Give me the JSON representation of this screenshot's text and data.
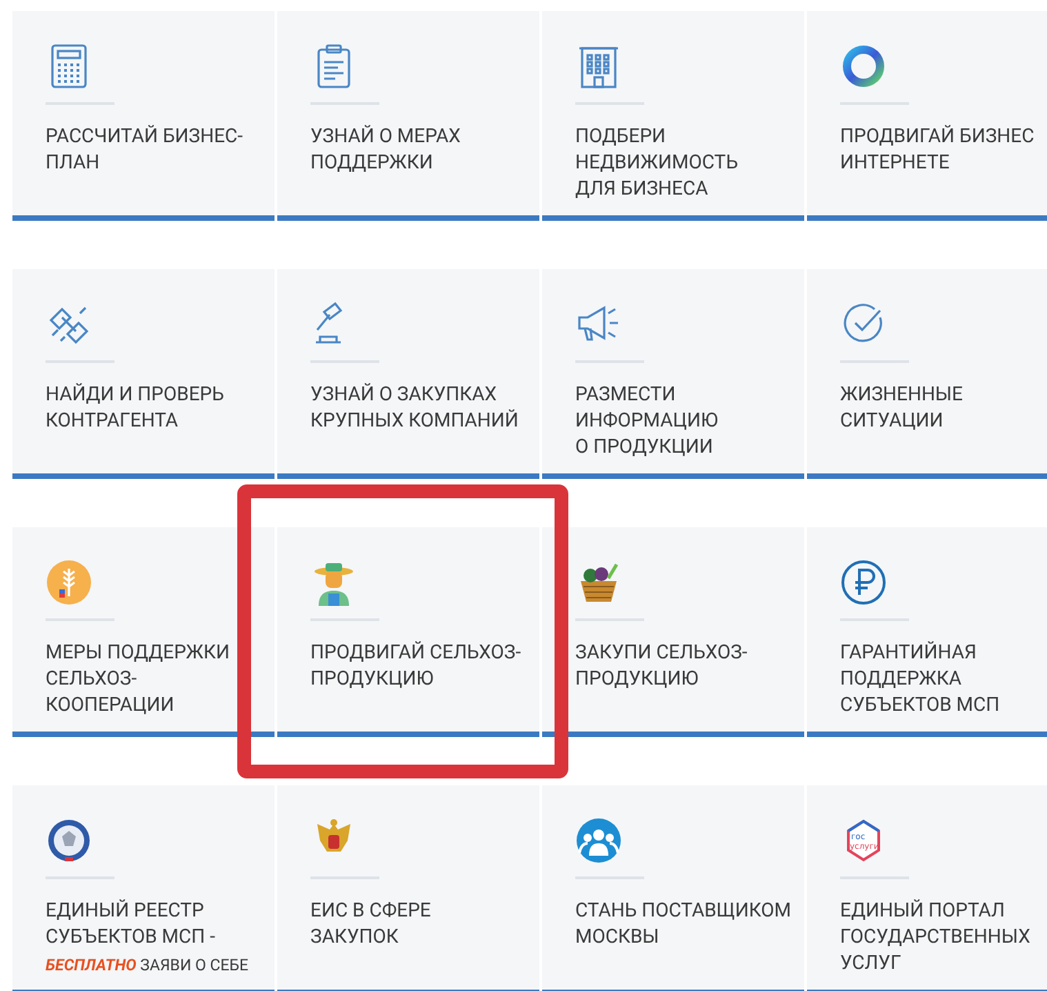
{
  "rows": [
    {
      "cards": [
        {
          "lines": [
            "РАССЧИТАЙ БИЗНЕС-",
            "ПЛАН"
          ],
          "highlighted": false
        },
        {
          "lines": [
            "УЗНАЙ О МЕРАХ",
            "ПОДДЕРЖКИ"
          ],
          "highlighted": false
        },
        {
          "lines": [
            "ПОДБЕРИ",
            "НЕДВИЖИМОСТЬ",
            "ДЛЯ БИЗНЕСА"
          ],
          "highlighted": false
        },
        {
          "lines": [
            "ПРОДВИГАЙ БИЗНЕС",
            "ИНТЕРНЕТЕ"
          ],
          "highlighted": false
        }
      ]
    },
    {
      "cards": [
        {
          "lines": [
            "НАЙДИ И ПРОВЕРЬ",
            "КОНТРАГЕНТА"
          ],
          "highlighted": false
        },
        {
          "lines": [
            "УЗНАЙ О ЗАКУПКАХ",
            "КРУПНЫХ КОМПАНИЙ"
          ],
          "highlighted": false
        },
        {
          "lines": [
            "РАЗМЕСТИ",
            "ИНФОРМАЦИЮ",
            "О ПРОДУКЦИИ"
          ],
          "highlighted": false
        },
        {
          "lines": [
            "ЖИЗНЕННЫЕ",
            "СИТУАЦИИ"
          ],
          "highlighted": false
        }
      ]
    },
    {
      "cards": [
        {
          "lines": [
            "МЕРЫ ПОДДЕРЖКИ",
            "СЕЛЬХОЗ-",
            "КООПЕРАЦИИ"
          ],
          "highlighted": false
        },
        {
          "lines": [
            "ПРОДВИГАЙ СЕЛЬХОЗ-",
            "ПРОДУКЦИЮ"
          ],
          "highlighted": true
        },
        {
          "lines": [
            "ЗАКУПИ СЕЛЬХОЗ-",
            "ПРОДУКЦИЮ"
          ],
          "highlighted": false
        },
        {
          "lines": [
            "ГАРАНТИЙНАЯ",
            "ПОДДЕРЖКА",
            "СУБЪЕКТОВ МСП"
          ],
          "highlighted": false
        }
      ]
    },
    {
      "cards": [
        {
          "lines": [
            "ЕДИНЫЙ РЕЕСТР",
            "СУБЪЕКТОВ МСП -"
          ],
          "note": "**БЕСПЛАТНО** ЗАЯВИ О СЕБЕ",
          "highlighted": false
        },
        {
          "lines": [
            "ЕИС В СФЕРЕ",
            "ЗАКУПОК"
          ],
          "highlighted": false
        },
        {
          "lines": [
            "СТАНЬ ПОСТАВЩИКОМ",
            "МОСКВЫ"
          ],
          "highlighted": false
        },
        {
          "lines": [
            "ЕДИНЫЙ ПОРТАЛ",
            "ГОСУДАРСТВЕННЫХ",
            "УСЛУГ"
          ],
          "logo_text": [
            "гос",
            "услуги"
          ],
          "highlighted": false
        }
      ]
    }
  ]
}
